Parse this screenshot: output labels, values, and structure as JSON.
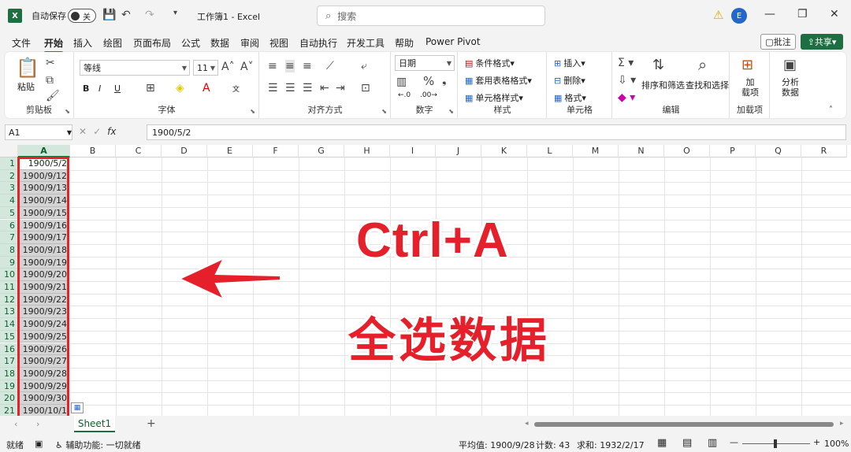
{
  "titlebar": {
    "app_icon": "X",
    "autosave_label": "自动保存",
    "autosave_state": "关",
    "doc_title": "工作簿1 - Excel",
    "search_placeholder": "搜索",
    "avatar": "E"
  },
  "menus": [
    "文件",
    "开始",
    "插入",
    "绘图",
    "页面布局",
    "公式",
    "数据",
    "审阅",
    "视图",
    "自动执行",
    "开发工具",
    "帮助",
    "Power Pivot"
  ],
  "actions": {
    "comment": "批注",
    "share": "共享"
  },
  "ribbon": {
    "clipboard": {
      "paste": "粘贴",
      "label": "剪贴板"
    },
    "font": {
      "name": "等线",
      "size": "11",
      "label": "字体"
    },
    "align": {
      "label": "对齐方式"
    },
    "number": {
      "format": "日期",
      "label": "数字"
    },
    "styles": {
      "cond": "条件格式",
      "table": "套用表格格式",
      "cell": "单元格样式",
      "label": "样式"
    },
    "cells": {
      "insert": "插入",
      "delete": "删除",
      "format": "格式",
      "label": "单元格"
    },
    "edit": {
      "sort": "排序和筛选",
      "find": "查找和选择",
      "label": "编辑"
    },
    "addins": {
      "add": "加\n载项",
      "label": "加载项"
    },
    "analysis": {
      "analyze": "分析\n数据"
    }
  },
  "formula_bar": {
    "name_box": "A1",
    "fx": "fx",
    "value": "1900/5/2"
  },
  "columns": [
    "A",
    "B",
    "C",
    "D",
    "E",
    "F",
    "G",
    "H",
    "I",
    "J",
    "K",
    "L",
    "M",
    "N",
    "O",
    "P",
    "Q",
    "R"
  ],
  "rows": [
    "1",
    "2",
    "3",
    "4",
    "5",
    "6",
    "7",
    "8",
    "9",
    "10",
    "11",
    "12",
    "13",
    "14",
    "15",
    "16",
    "17",
    "18",
    "19",
    "20",
    "21"
  ],
  "cells_a": [
    "1900/5/2",
    "1900/9/12",
    "1900/9/13",
    "1900/9/14",
    "1900/9/15",
    "1900/9/16",
    "1900/9/17",
    "1900/9/18",
    "1900/9/19",
    "1900/9/20",
    "1900/9/21",
    "1900/9/22",
    "1900/9/23",
    "1900/9/24",
    "1900/9/25",
    "1900/9/26",
    "1900/9/27",
    "1900/9/28",
    "1900/9/29",
    "1900/9/30",
    "1900/10/1"
  ],
  "overlay": {
    "shortcut": "Ctrl+A",
    "caption": "全选数据",
    "arrow_color": "#e5202a"
  },
  "sheet_tab": "Sheet1",
  "status": {
    "ready": "就绪",
    "accessibility": "辅助功能: 一切就绪",
    "average": "平均值: 1900/9/28",
    "count": "计数: 43",
    "sum": "求和: 1932/2/17",
    "zoom": "100%"
  },
  "colors": {
    "accent": "#1d6f42",
    "highlight": "#e52229"
  }
}
